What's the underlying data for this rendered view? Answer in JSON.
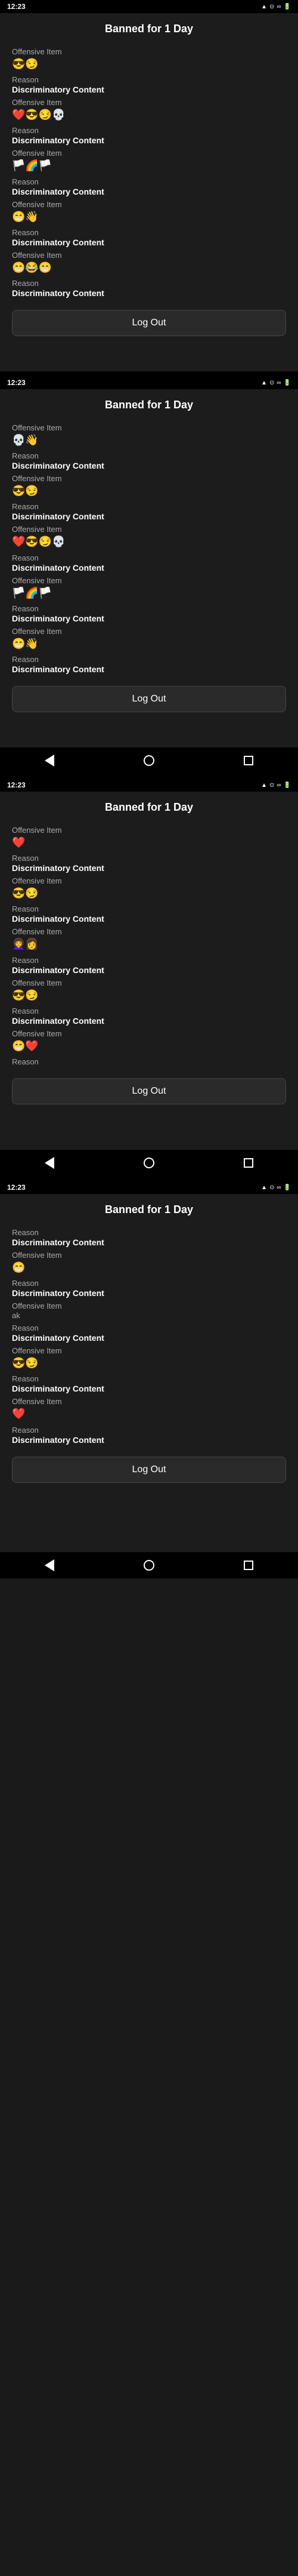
{
  "screens": [
    {
      "id": "screen1",
      "title": "Banned for 1 Day",
      "hasStatusBar": true,
      "statusBar": {
        "left": "12:23",
        "rightIcons": [
          "signal",
          "wifi",
          "battery"
        ]
      },
      "items": [
        {
          "label": "Offensive Item",
          "value": "😎😏",
          "isEmoji": true
        },
        {
          "label": "Reason",
          "value": "Discriminatory Content",
          "isBold": true
        },
        {
          "label": "Offensive Item",
          "value": "❤️😎😏💀",
          "isEmoji": true
        },
        {
          "label": "Reason",
          "value": "Discriminatory Content",
          "isBold": true
        },
        {
          "label": "Offensive Item",
          "value": "🏳️🌈🏳️",
          "isEmoji": true
        },
        {
          "label": "Reason",
          "value": "Discriminatory Content",
          "isBold": true
        },
        {
          "label": "Offensive Item",
          "value": "😁👋",
          "isEmoji": true
        },
        {
          "label": "Reason",
          "value": "Discriminatory Content",
          "isBold": true
        },
        {
          "label": "Offensive Item",
          "value": "😁😂😁",
          "isEmoji": true
        },
        {
          "label": "Reason",
          "value": "Discriminatory Content",
          "isBold": true
        }
      ],
      "logoutLabel": "Log Out",
      "hasNavBar": false
    },
    {
      "id": "screen2",
      "title": "Banned for 1 Day",
      "hasStatusBar": true,
      "statusBar": {
        "left": "12:23",
        "rightIcons": [
          "signal",
          "wifi",
          "battery"
        ]
      },
      "items": [
        {
          "label": "Offensive Item",
          "value": "💀👋",
          "isEmoji": true
        },
        {
          "label": "Reason",
          "value": "Discriminatory Content",
          "isBold": true
        },
        {
          "label": "Offensive Item",
          "value": "😎😏",
          "isEmoji": true
        },
        {
          "label": "Reason",
          "value": "Discriminatory Content",
          "isBold": true
        },
        {
          "label": "Offensive Item",
          "value": "❤️😎😏💀",
          "isEmoji": true
        },
        {
          "label": "Reason",
          "value": "Discriminatory Content",
          "isBold": true
        },
        {
          "label": "Offensive Item",
          "value": "🏳️🌈🏳️",
          "isEmoji": true
        },
        {
          "label": "Reason",
          "value": "Discriminatory Content",
          "isBold": true
        },
        {
          "label": "Offensive Item",
          "value": "😁👋",
          "isEmoji": true
        },
        {
          "label": "Reason",
          "value": "Discriminatory Content",
          "isBold": true
        }
      ],
      "logoutLabel": "Log Out",
      "hasNavBar": true
    },
    {
      "id": "screen3",
      "title": "Banned for 1 Day",
      "hasStatusBar": true,
      "statusBar": {
        "left": "12:23",
        "rightIcons": [
          "signal",
          "wifi",
          "battery"
        ]
      },
      "items": [
        {
          "label": "Offensive Item",
          "value": "❤️",
          "isEmoji": true
        },
        {
          "label": "Reason",
          "value": "Discriminatory Content",
          "isBold": true
        },
        {
          "label": "Offensive Item",
          "value": "😎😏",
          "isEmoji": true
        },
        {
          "label": "Reason",
          "value": "Discriminatory Content",
          "isBold": true
        },
        {
          "label": "Offensive Item",
          "value": "👩‍🦱👩",
          "isEmoji": true
        },
        {
          "label": "Reason",
          "value": "Discriminatory Content",
          "isBold": true
        },
        {
          "label": "Offensive Item",
          "value": "😎😏",
          "isEmoji": true
        },
        {
          "label": "Reason",
          "value": "Discriminatory Content",
          "isBold": true
        },
        {
          "label": "Offensive Item",
          "value": "😁❤️",
          "isEmoji": true
        },
        {
          "label": "Reason",
          "value": "",
          "isBold": false
        }
      ],
      "logoutLabel": "Log Out",
      "hasNavBar": true
    },
    {
      "id": "screen4",
      "title": "Banned for 1 Day",
      "hasStatusBar": true,
      "statusBar": {
        "left": "12:23",
        "rightIcons": [
          "signal",
          "wifi",
          "battery"
        ]
      },
      "items": [
        {
          "label": "Reason",
          "value": "Discriminatory Content",
          "isBold": true
        },
        {
          "label": "Offensive Item",
          "value": "😁",
          "isEmoji": true
        },
        {
          "label": "Reason",
          "value": "Discriminatory Content",
          "isBold": true
        },
        {
          "label": "Offensive Item",
          "value": "ak",
          "isEmoji": false
        },
        {
          "label": "Reason",
          "value": "Discriminatory Content",
          "isBold": true
        },
        {
          "label": "Offensive Item",
          "value": "😎😏",
          "isEmoji": true
        },
        {
          "label": "Reason",
          "value": "Discriminatory Content",
          "isBold": true
        },
        {
          "label": "Offensive Item",
          "value": "❤️",
          "isEmoji": true
        },
        {
          "label": "Reason",
          "value": "Discriminatory Content",
          "isBold": true
        }
      ],
      "logoutLabel": "Log Out",
      "hasNavBar": true
    }
  ]
}
